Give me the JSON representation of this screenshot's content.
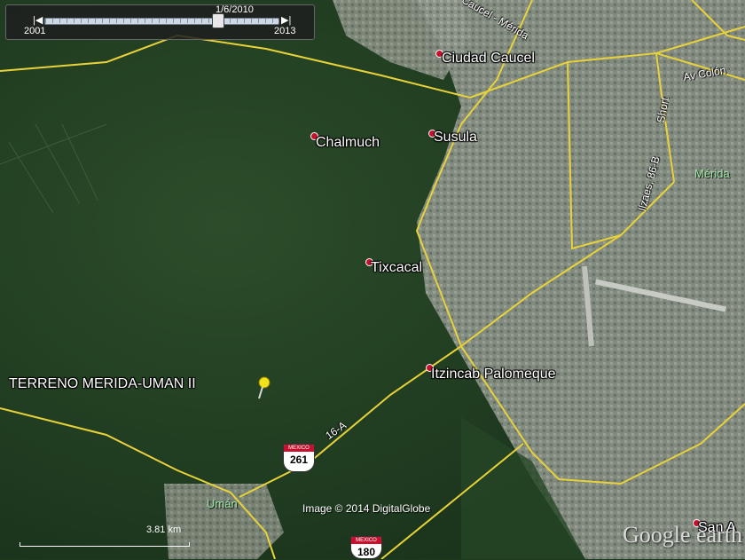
{
  "timebar": {
    "date": "1/6/2010",
    "start_year": "2001",
    "end_year": "2013",
    "position": 0.74
  },
  "places": [
    {
      "id": "ciudad-caucel",
      "label": "Ciudad Caucel"
    },
    {
      "id": "chalmuch",
      "label": "Chalmuch"
    },
    {
      "id": "susula",
      "label": "Susula"
    },
    {
      "id": "tixcacal",
      "label": "Tixcacal"
    },
    {
      "id": "itzincab-palomeque",
      "label": "Itzincab Palomeque"
    },
    {
      "id": "san-a",
      "label": "San A"
    }
  ],
  "property_label": "TERRENO MERIDA-UMAN II",
  "city_labels": {
    "merida": "Mérida",
    "uman": "Umán"
  },
  "road_labels": {
    "caucel_merida": "Caucel - Mérida",
    "av_colon": "Av Colón",
    "short": "Short",
    "ilzaes": "Ilzaes, 86-B",
    "r16a": "16-A"
  },
  "shields": {
    "s261_top": "MEXICO",
    "s261": "261",
    "s180_top": "MEXICO",
    "s180": "180"
  },
  "credit": "Image © 2014 DigitalGlobe",
  "scale": "3.81 km",
  "logo": "Google earth",
  "colors": {
    "road": "#e8d23a",
    "pin": "#f2e219",
    "place_dot": "#c8102e",
    "urban": "#8a8f86"
  }
}
